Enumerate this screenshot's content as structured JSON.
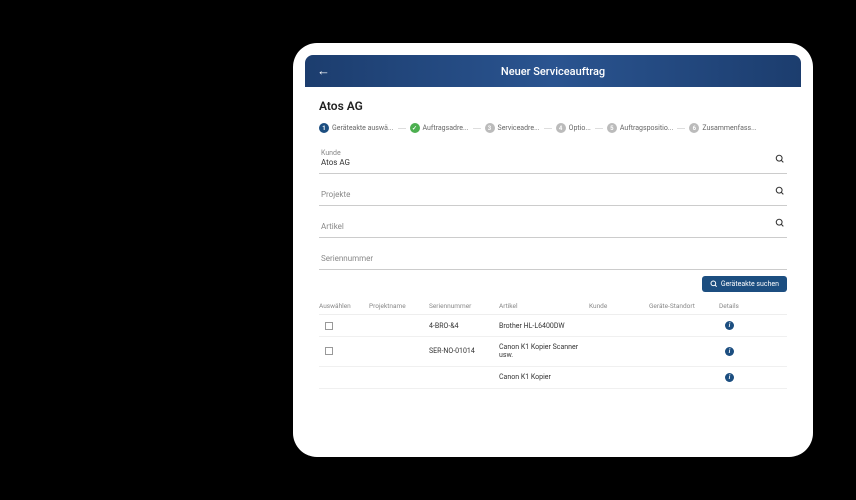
{
  "header": {
    "title": "Neuer Serviceauftrag"
  },
  "company": "Atos AG",
  "stepper": {
    "s1": "Geräteakte auswä...",
    "s2": "Auftragsadre...",
    "s3": "Serviceadre...",
    "s4": "Optio...",
    "s5": "Auftragspositio...",
    "s6": "Zusammenfass..."
  },
  "fields": {
    "kunde_label": "Kunde",
    "kunde_value": "Atos AG",
    "projekte": "Projekte",
    "artikel": "Artikel",
    "seriennummer": "Seriennummer"
  },
  "search_button": "Geräteakte suchen",
  "table": {
    "headers": {
      "auswaehlen": "Auswählen",
      "projektname": "Projektname",
      "seriennummer": "Seriennummer",
      "artikel": "Artikel",
      "kunde": "Kunde",
      "standort": "Geräte-Standort",
      "details": "Details"
    },
    "rows": [
      {
        "sn": "4-BRO-&4",
        "artikel": "Brother HL-L6400DW"
      },
      {
        "sn": "SER-NO-01014",
        "artikel": "Canon K1 Kopier Scanner usw."
      },
      {
        "sn": "",
        "artikel": "Canon K1 Kopier"
      }
    ]
  }
}
